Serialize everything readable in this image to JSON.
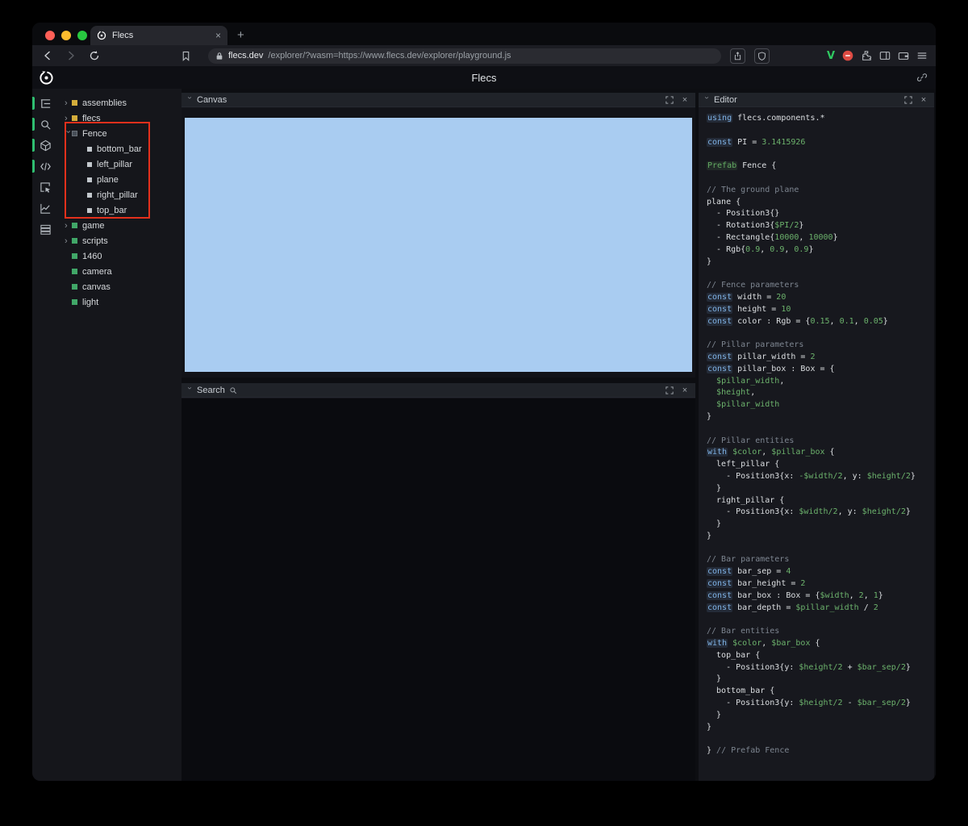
{
  "browser": {
    "tab": {
      "title": "Flecs"
    },
    "new_tab_label": "+",
    "close_label": "×",
    "url": {
      "domain": "flecs.dev",
      "path": "/explorer/?wasm=https://www.flecs.dev/explorer/playground.js"
    },
    "extensions": {
      "v_label": "V"
    }
  },
  "app": {
    "title": "Flecs"
  },
  "sidebar": {
    "icons": [
      "entity-tree-icon",
      "search-icon",
      "cube-icon",
      "code-icon",
      "inspect-icon",
      "chart-icon",
      "stats-icon"
    ]
  },
  "tree": {
    "items": [
      {
        "label": "assemblies",
        "bullet": "yellow",
        "arrow": "collapsed",
        "depth": 0
      },
      {
        "label": "flecs",
        "bullet": "yellow",
        "arrow": "collapsed",
        "depth": 0
      },
      {
        "label": "Fence",
        "bullet": "dark",
        "arrow": "expanded",
        "depth": 0
      },
      {
        "label": "bottom_bar",
        "bullet": "gray",
        "arrow": "none",
        "depth": 1
      },
      {
        "label": "left_pillar",
        "bullet": "gray",
        "arrow": "none",
        "depth": 1
      },
      {
        "label": "plane",
        "bullet": "gray",
        "arrow": "none",
        "depth": 1
      },
      {
        "label": "right_pillar",
        "bullet": "gray",
        "arrow": "none",
        "depth": 1
      },
      {
        "label": "top_bar",
        "bullet": "gray",
        "arrow": "none",
        "depth": 1
      },
      {
        "label": "game",
        "bullet": "green",
        "arrow": "collapsed",
        "depth": 0
      },
      {
        "label": "scripts",
        "bullet": "green",
        "arrow": "collapsed",
        "depth": 0
      },
      {
        "label": "1460",
        "bullet": "green",
        "arrow": "none",
        "depth": 0
      },
      {
        "label": "camera",
        "bullet": "green",
        "arrow": "none",
        "depth": 0
      },
      {
        "label": "canvas",
        "bullet": "green",
        "arrow": "none",
        "depth": 0
      },
      {
        "label": "light",
        "bullet": "green",
        "arrow": "none",
        "depth": 0
      }
    ]
  },
  "panels": {
    "canvas": {
      "title": "Canvas"
    },
    "search": {
      "title": "Search"
    },
    "editor": {
      "title": "Editor"
    }
  },
  "annotation": {
    "color": "#e3301c"
  },
  "colors": {
    "canvas_blue": "#a9ccf1",
    "accent_green": "#2fbf71",
    "tree_yellow": "#d4ad3b",
    "tree_green": "#41a768"
  },
  "editor_code": {
    "lines": [
      [
        {
          "t": "using",
          "c": "k"
        },
        {
          "t": " flecs.components.*",
          "c": "p"
        }
      ],
      [],
      [
        {
          "t": "const",
          "c": "k"
        },
        {
          "t": " PI = ",
          "c": "p"
        },
        {
          "t": "3.1415926",
          "c": "g"
        }
      ],
      [],
      [
        {
          "t": "Prefab",
          "c": "t"
        },
        {
          "t": " Fence {",
          "c": "p"
        }
      ],
      [],
      [
        {
          "t": "// The ground plane",
          "c": "c"
        }
      ],
      [
        {
          "t": "plane {",
          "c": "p"
        }
      ],
      [
        {
          "t": "  - Position3{}",
          "c": "p"
        }
      ],
      [
        {
          "t": "  - Rotation3{",
          "c": "p"
        },
        {
          "t": "$PI/2",
          "c": "g"
        },
        {
          "t": "}",
          "c": "p"
        }
      ],
      [
        {
          "t": "  - Rectangle{",
          "c": "p"
        },
        {
          "t": "10000",
          "c": "g"
        },
        {
          "t": ", ",
          "c": "p"
        },
        {
          "t": "10000",
          "c": "g"
        },
        {
          "t": "}",
          "c": "p"
        }
      ],
      [
        {
          "t": "  - Rgb{",
          "c": "p"
        },
        {
          "t": "0.9",
          "c": "g"
        },
        {
          "t": ", ",
          "c": "p"
        },
        {
          "t": "0.9",
          "c": "g"
        },
        {
          "t": ", ",
          "c": "p"
        },
        {
          "t": "0.9",
          "c": "g"
        },
        {
          "t": "}",
          "c": "p"
        }
      ],
      [
        {
          "t": "}",
          "c": "p"
        }
      ],
      [],
      [
        {
          "t": "// Fence parameters",
          "c": "c"
        }
      ],
      [
        {
          "t": "const",
          "c": "k"
        },
        {
          "t": " width = ",
          "c": "p"
        },
        {
          "t": "20",
          "c": "g"
        }
      ],
      [
        {
          "t": "const",
          "c": "k"
        },
        {
          "t": " height = ",
          "c": "p"
        },
        {
          "t": "10",
          "c": "g"
        }
      ],
      [
        {
          "t": "const",
          "c": "k"
        },
        {
          "t": " color : Rgb = {",
          "c": "p"
        },
        {
          "t": "0.15",
          "c": "g"
        },
        {
          "t": ", ",
          "c": "p"
        },
        {
          "t": "0.1",
          "c": "g"
        },
        {
          "t": ", ",
          "c": "p"
        },
        {
          "t": "0.05",
          "c": "g"
        },
        {
          "t": "}",
          "c": "p"
        }
      ],
      [],
      [
        {
          "t": "// Pillar parameters",
          "c": "c"
        }
      ],
      [
        {
          "t": "const",
          "c": "k"
        },
        {
          "t": " pillar_width = ",
          "c": "p"
        },
        {
          "t": "2",
          "c": "g"
        }
      ],
      [
        {
          "t": "const",
          "c": "k"
        },
        {
          "t": " pillar_box : Box = {",
          "c": "p"
        }
      ],
      [
        {
          "t": "  ",
          "c": "p"
        },
        {
          "t": "$pillar_width",
          "c": "g"
        },
        {
          "t": ",",
          "c": "p"
        }
      ],
      [
        {
          "t": "  ",
          "c": "p"
        },
        {
          "t": "$height",
          "c": "g"
        },
        {
          "t": ",",
          "c": "p"
        }
      ],
      [
        {
          "t": "  ",
          "c": "p"
        },
        {
          "t": "$pillar_width",
          "c": "g"
        }
      ],
      [
        {
          "t": "}",
          "c": "p"
        }
      ],
      [],
      [
        {
          "t": "// Pillar entities",
          "c": "c"
        }
      ],
      [
        {
          "t": "with",
          "c": "k"
        },
        {
          "t": " ",
          "c": "p"
        },
        {
          "t": "$color",
          "c": "g"
        },
        {
          "t": ", ",
          "c": "p"
        },
        {
          "t": "$pillar_box",
          "c": "g"
        },
        {
          "t": " {",
          "c": "p"
        }
      ],
      [
        {
          "t": "  left_pillar {",
          "c": "p"
        }
      ],
      [
        {
          "t": "    - Position3{x: ",
          "c": "p"
        },
        {
          "t": "-$width/2",
          "c": "g"
        },
        {
          "t": ", y: ",
          "c": "p"
        },
        {
          "t": "$height/2",
          "c": "g"
        },
        {
          "t": "}",
          "c": "p"
        }
      ],
      [
        {
          "t": "  }",
          "c": "p"
        }
      ],
      [
        {
          "t": "  right_pillar {",
          "c": "p"
        }
      ],
      [
        {
          "t": "    - Position3{x: ",
          "c": "p"
        },
        {
          "t": "$width/2",
          "c": "g"
        },
        {
          "t": ", y: ",
          "c": "p"
        },
        {
          "t": "$height/2",
          "c": "g"
        },
        {
          "t": "}",
          "c": "p"
        }
      ],
      [
        {
          "t": "  }",
          "c": "p"
        }
      ],
      [
        {
          "t": "}",
          "c": "p"
        }
      ],
      [],
      [
        {
          "t": "// Bar parameters",
          "c": "c"
        }
      ],
      [
        {
          "t": "const",
          "c": "k"
        },
        {
          "t": " bar_sep = ",
          "c": "p"
        },
        {
          "t": "4",
          "c": "g"
        }
      ],
      [
        {
          "t": "const",
          "c": "k"
        },
        {
          "t": " bar_height = ",
          "c": "p"
        },
        {
          "t": "2",
          "c": "g"
        }
      ],
      [
        {
          "t": "const",
          "c": "k"
        },
        {
          "t": " bar_box : Box = {",
          "c": "p"
        },
        {
          "t": "$width",
          "c": "g"
        },
        {
          "t": ", ",
          "c": "p"
        },
        {
          "t": "2",
          "c": "g"
        },
        {
          "t": ", ",
          "c": "p"
        },
        {
          "t": "1",
          "c": "g"
        },
        {
          "t": "}",
          "c": "p"
        }
      ],
      [
        {
          "t": "const",
          "c": "k"
        },
        {
          "t": " bar_depth = ",
          "c": "p"
        },
        {
          "t": "$pillar_width",
          "c": "g"
        },
        {
          "t": " / ",
          "c": "p"
        },
        {
          "t": "2",
          "c": "g"
        }
      ],
      [],
      [
        {
          "t": "// Bar entities",
          "c": "c"
        }
      ],
      [
        {
          "t": "with",
          "c": "k"
        },
        {
          "t": " ",
          "c": "p"
        },
        {
          "t": "$color",
          "c": "g"
        },
        {
          "t": ", ",
          "c": "p"
        },
        {
          "t": "$bar_box",
          "c": "g"
        },
        {
          "t": " {",
          "c": "p"
        }
      ],
      [
        {
          "t": "  top_bar {",
          "c": "p"
        }
      ],
      [
        {
          "t": "    - Position3{y: ",
          "c": "p"
        },
        {
          "t": "$height/2",
          "c": "g"
        },
        {
          "t": " + ",
          "c": "p"
        },
        {
          "t": "$bar_sep/2",
          "c": "g"
        },
        {
          "t": "}",
          "c": "p"
        }
      ],
      [
        {
          "t": "  }",
          "c": "p"
        }
      ],
      [
        {
          "t": "  bottom_bar {",
          "c": "p"
        }
      ],
      [
        {
          "t": "    - Position3{y: ",
          "c": "p"
        },
        {
          "t": "$height/2",
          "c": "g"
        },
        {
          "t": " - ",
          "c": "p"
        },
        {
          "t": "$bar_sep/2",
          "c": "g"
        },
        {
          "t": "}",
          "c": "p"
        }
      ],
      [
        {
          "t": "  }",
          "c": "p"
        }
      ],
      [
        {
          "t": "}",
          "c": "p"
        }
      ],
      [],
      [
        {
          "t": "} ",
          "c": "p"
        },
        {
          "t": "// Prefab Fence",
          "c": "c"
        }
      ]
    ]
  }
}
